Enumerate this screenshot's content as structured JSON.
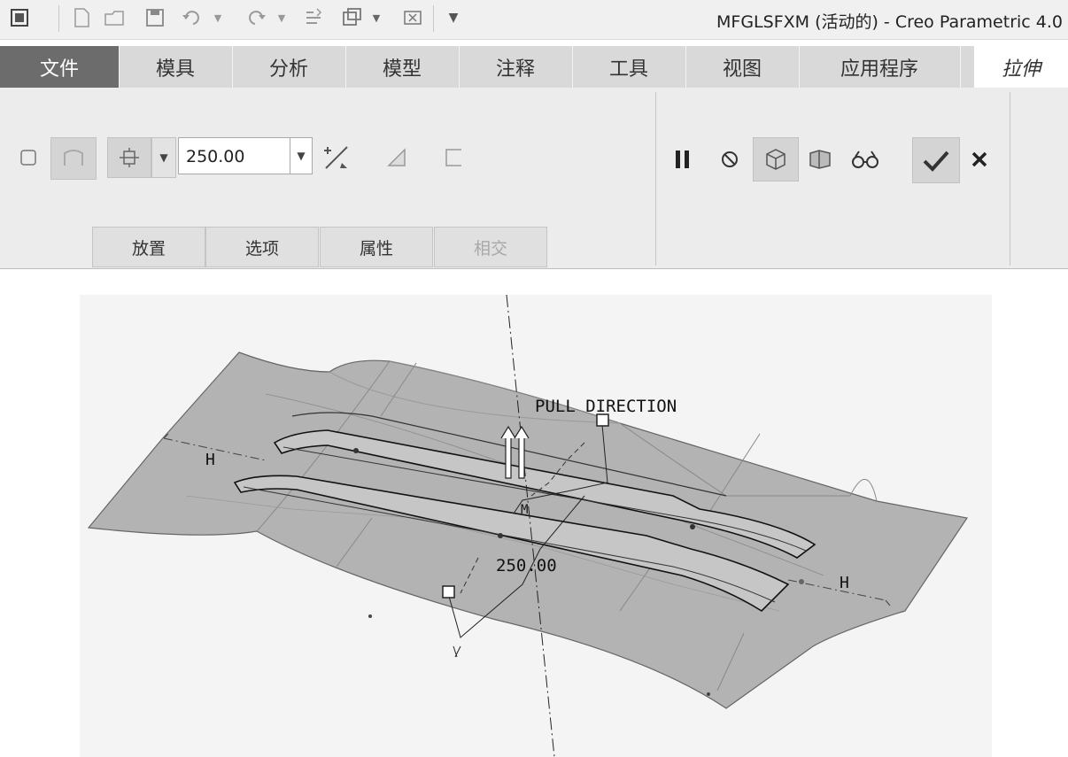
{
  "window": {
    "title": "MFGLSFXM (活动的) - Creo Parametric 4.0"
  },
  "quick_access": {
    "icons": [
      "app-menu-icon",
      "new-file-icon",
      "open-folder-icon",
      "save-icon",
      "undo-icon",
      "redo-icon",
      "regenerate-icon",
      "window-icon",
      "close-window-icon",
      "customize-icon"
    ]
  },
  "menu": {
    "items": [
      "文件",
      "模具",
      "分析",
      "模型",
      "注释",
      "工具",
      "视图",
      "应用程序"
    ],
    "active_tab": "拉伸"
  },
  "ribbon": {
    "depth_value": "250.00",
    "subtabs": [
      "放置",
      "选项",
      "属性",
      "相交"
    ]
  },
  "viewport": {
    "pull_direction_label": "PULL DIRECTION",
    "dimension_label": "250.00",
    "plane_label_left": "H",
    "plane_label_right": "H"
  }
}
